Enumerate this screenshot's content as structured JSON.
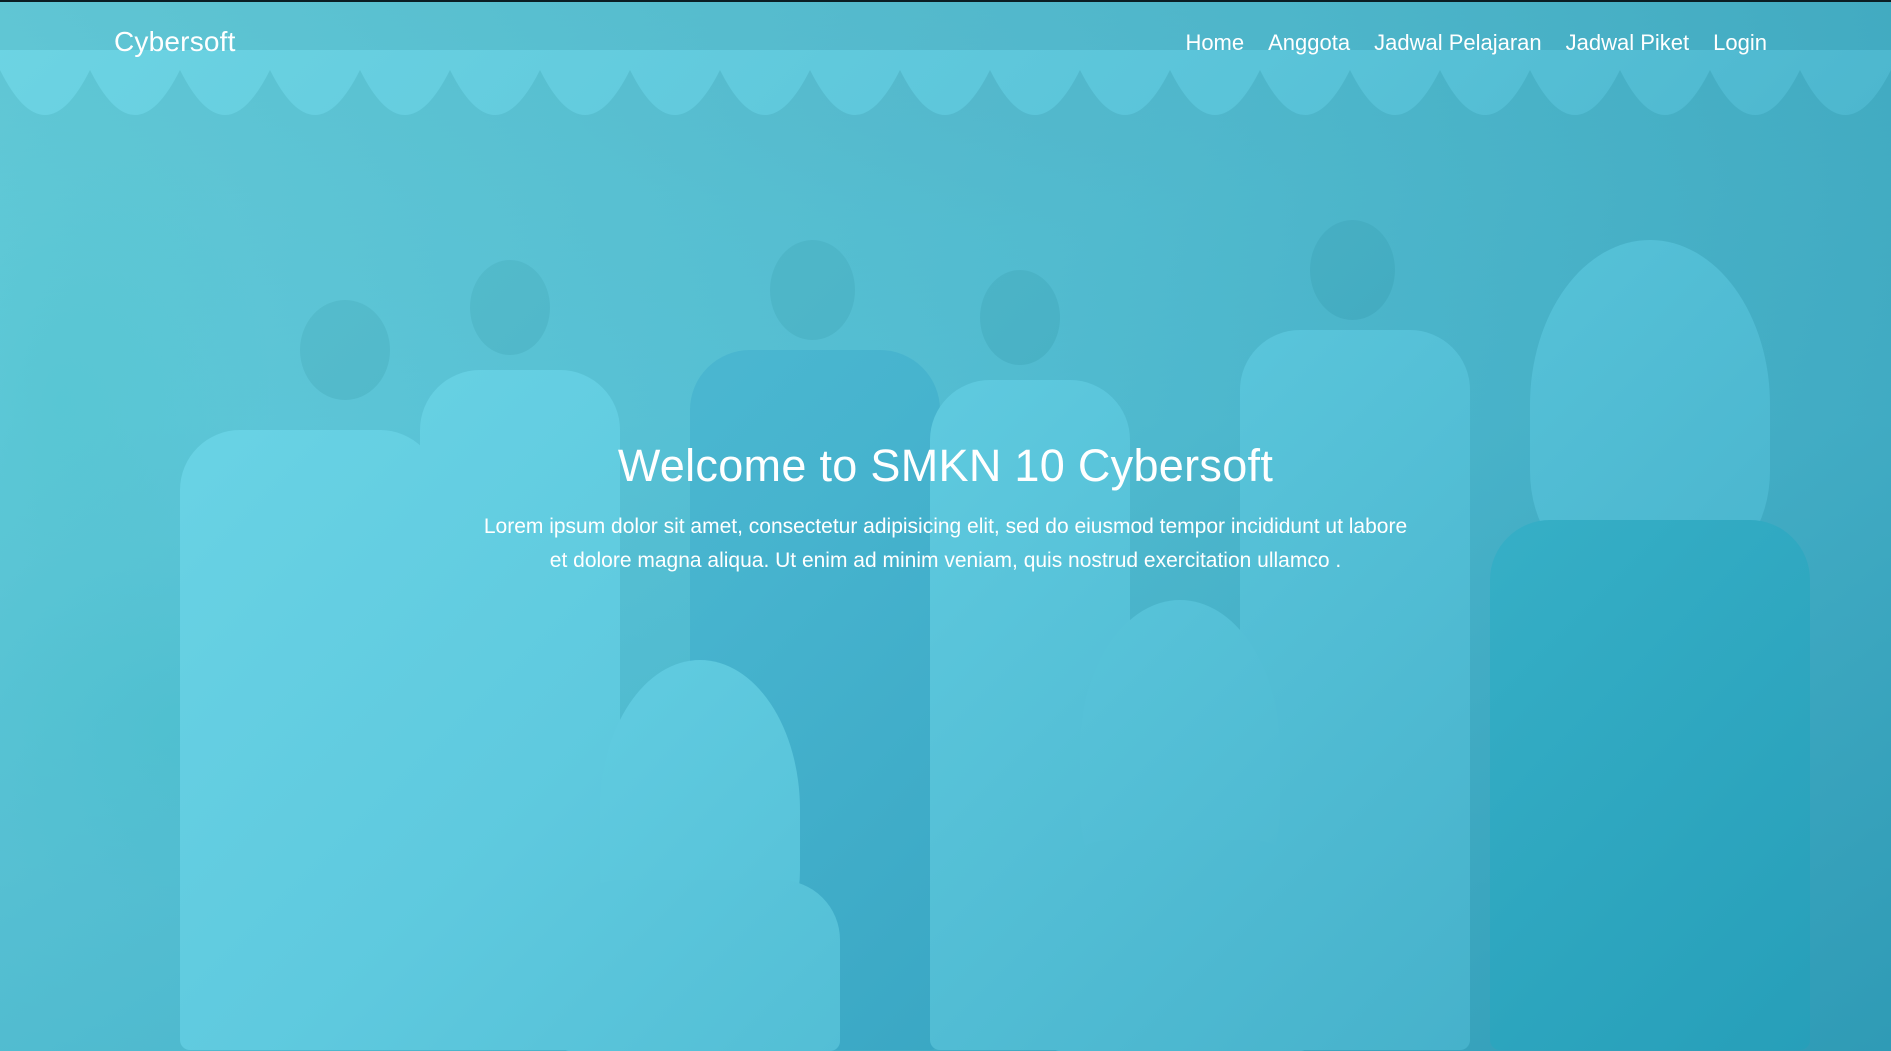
{
  "navbar": {
    "brand": "Cybersoft",
    "links": [
      "Home",
      "Anggota",
      "Jadwal Pelajaran",
      "Jadwal Piket",
      "Login"
    ]
  },
  "hero": {
    "title": "Welcome to SMKN 10 Cybersoft",
    "text": "Lorem ipsum dolor sit amet, consectetur adipisicing elit, sed do eiusmod tempor incididunt ut labore et dolore magna aliqua. Ut enim ad minim veniam, quis nostrud exercitation ullamco ."
  },
  "colors": {
    "overlay_start": "#5ed7e8",
    "overlay_end": "#26a0be",
    "text": "#ffffff"
  }
}
